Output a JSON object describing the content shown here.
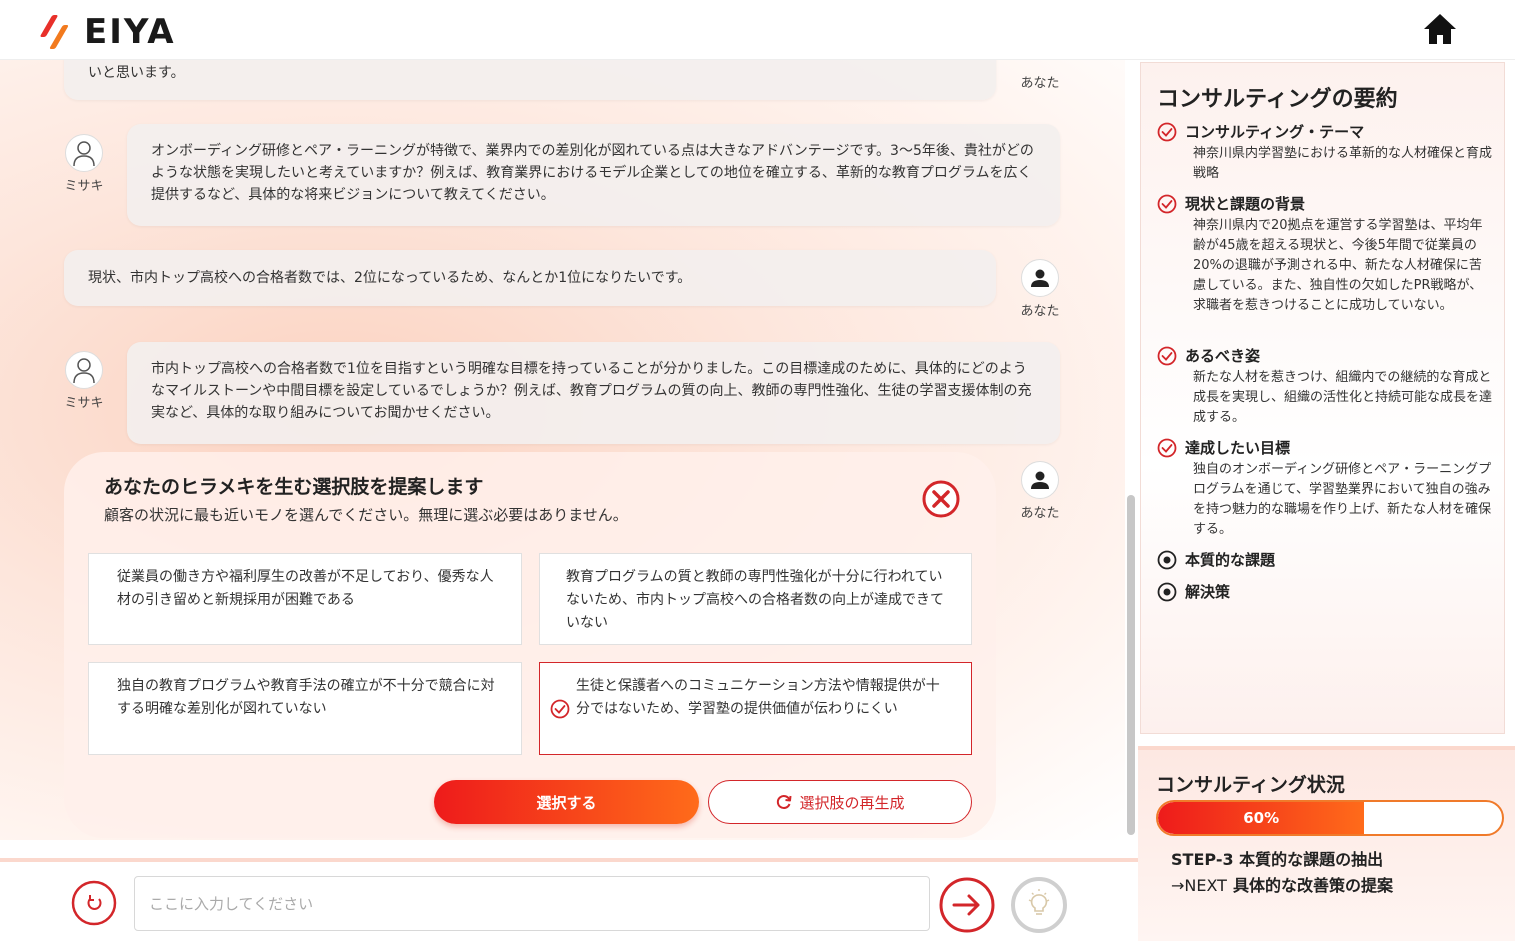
{
  "app": {
    "logo_text": "EIYA",
    "brand_color": "#e8302a",
    "accent_color": "#ff6b1a"
  },
  "header": {
    "home_icon": "home-icon"
  },
  "chat": {
    "messages": [
      {
        "role": "user",
        "name": "あなた",
        "text": "いと思います。"
      },
      {
        "role": "assistant",
        "name": "ミサキ",
        "text": "オンボーディング研修とペア・ラーニングが特徴で、業界内での差別化が図れている点は大きなアドバンテージです。3〜5年後、貴社がどのような状態を実現したいと考えていますか？例えば、教育業界におけるモデル企業としての地位を確立する、革新的な教育プログラムを広く提供するなど、具体的な将来ビジョンについて教えてください。"
      },
      {
        "role": "user",
        "name": "あなた",
        "text": "現状、市内トップ高校への合格者数では、2位になっているため、なんとか1位になりたいです。"
      },
      {
        "role": "assistant",
        "name": "ミサキ",
        "text": "市内トップ高校への合格者数で1位を目指すという明確な目標を持っていることが分かりました。この目標達成のために、具体的にどのようなマイルストーンや中間目標を設定しているでしょうか？例えば、教育プログラムの質の向上、教師の専門性強化、生徒の学習支援体制の充実など、具体的な取り組みについてお聞かせください。"
      }
    ],
    "suggest": {
      "user_name": "あなた",
      "title": "あなたのヒラメキを生む選択肢を提案します",
      "subtitle": "顧客の状況に最も近いモノを選んでください。無理に選ぶ必要はありません。",
      "options": [
        {
          "text": "従業員の働き方や福利厚生の改善が不足しており、優秀な人材の引き留めと新規採用が困難である",
          "selected": false
        },
        {
          "text": "教育プログラムの質と教師の専門性強化が十分に行われていないため、市内トップ高校への合格者数の向上が達成できていない",
          "selected": false
        },
        {
          "text": "独自の教育プログラムや教育手法の確立が不十分で競合に対する明確な差別化が図れていない",
          "selected": false
        },
        {
          "text": "生徒と保護者へのコミュニケーション方法や情報提供が十分ではないため、学習塾の提供価値が伝わりにくい",
          "selected": true
        }
      ],
      "select_label": "選択する",
      "regen_label": "選択肢の再生成"
    }
  },
  "input": {
    "placeholder": "ここに入力してください",
    "value": ""
  },
  "summary": {
    "title": "コンサルティングの要約",
    "items": [
      {
        "label": "コンサルティング・テーマ",
        "status": "done",
        "body": "神奈川県内学習塾における革新的な人材確保と育成戦略"
      },
      {
        "label": "現状と課題の背景",
        "status": "done",
        "body": "神奈川県内で20拠点を運営する学習塾は、平均年齢が45歳を超える現状と、今後5年間で従業員の20%の退職が予測される中、新たな人材確保に苦慮している。また、独自性の欠如したPR戦略が、求職者を惹きつけることに成功していない。"
      },
      {
        "label": "あるべき姿",
        "status": "done",
        "body": "新たな人材を惹きつけ、組織内での継続的な育成と成長を実現し、組織の活性化と持続可能な成長を達成する。"
      },
      {
        "label": "達成したい目標",
        "status": "done",
        "body": "独自のオンボーディング研修とペア・ラーニングプログラムを通じて、学習塾業界において独自の強みを持つ魅力的な職場を作り上げ、新たな人材を確保する。"
      },
      {
        "label": "本質的な課題",
        "status": "current",
        "body": ""
      },
      {
        "label": "解決策",
        "status": "current",
        "body": ""
      }
    ]
  },
  "status": {
    "title": "コンサルティング状況",
    "progress": 0.6,
    "progress_label": "60%",
    "step": "STEP-3 本質的な課題の抽出",
    "next_prefix": "→NEXT",
    "next_label": "具体的な改善策の提案"
  }
}
